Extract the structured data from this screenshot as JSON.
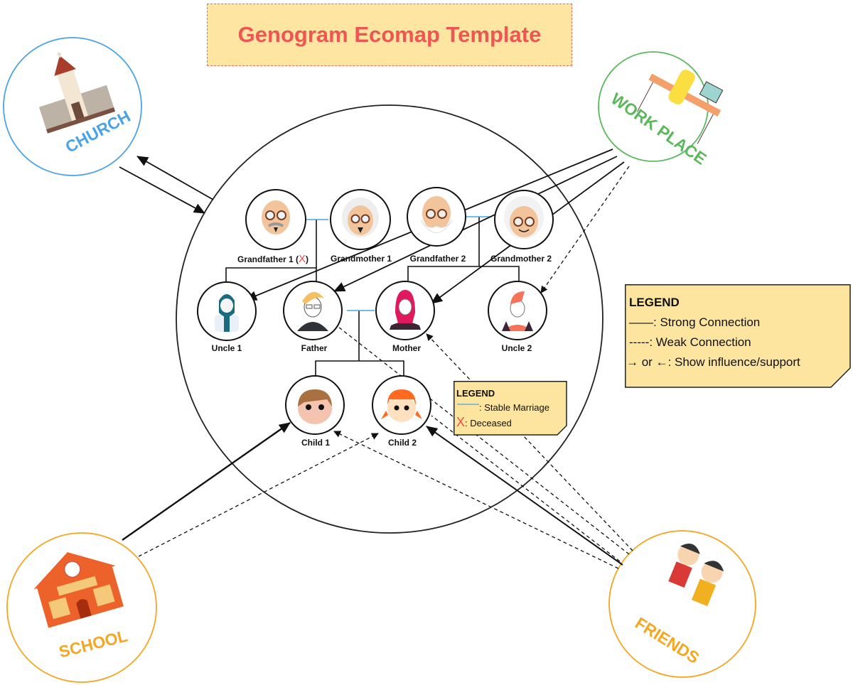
{
  "title": "Genogram Ecomap Template",
  "colors": {
    "title_text": "#ef5552",
    "title_bg": "#fee6a2",
    "legend_bg": "#fde49f",
    "marriage_line": "#4aa3e6",
    "deceased_x": "#ef4d4d",
    "church": "#4aa3e6",
    "workplace": "#5cb85c",
    "school": "#f5a623",
    "friends": "#f5a623"
  },
  "family": {
    "grandfather1": {
      "label": "Grandfather 1 (",
      "deceased_mark": "X",
      "label_end": ")"
    },
    "grandmother1": {
      "label": "Grandmother 1"
    },
    "grandfather2": {
      "label": "Grandfather 2"
    },
    "grandmother2": {
      "label": "Grandmother 2"
    },
    "uncle1": {
      "label": "Uncle 1"
    },
    "father": {
      "label": "Father"
    },
    "mother": {
      "label": "Mother"
    },
    "uncle2": {
      "label": "Uncle 2"
    },
    "child1": {
      "label": "Child 1"
    },
    "child2": {
      "label": "Child 2"
    }
  },
  "ecosystems": {
    "church": {
      "label": "CHURCH"
    },
    "workplace": {
      "label": "WORK PLACE"
    },
    "school": {
      "label": "SCHOOL",
      "sign": "SCHOOL"
    },
    "friends": {
      "label": "FRIENDS"
    }
  },
  "legend_main": {
    "title": "LEGEND",
    "items": [
      {
        "symbol": "——",
        "text": ": Strong Connection"
      },
      {
        "symbol": "-----",
        "text": ": Weak Connection"
      },
      {
        "symbol": "→ or ←",
        "text": ": Show influence/support"
      }
    ]
  },
  "legend_small": {
    "title": "LEGEND",
    "items": [
      {
        "symbol": "marriage-line",
        "text": ": Stable Marriage"
      },
      {
        "symbol": "X",
        "text": ": Deceased"
      }
    ]
  },
  "connections": [
    {
      "from": "church",
      "to": "family",
      "type": "strong",
      "direction": "to"
    },
    {
      "from": "family",
      "to": "church",
      "type": "strong",
      "direction": "to"
    },
    {
      "from": "workplace",
      "to": "uncle1",
      "type": "strong"
    },
    {
      "from": "workplace",
      "to": "father",
      "type": "strong"
    },
    {
      "from": "workplace",
      "to": "mother",
      "type": "strong"
    },
    {
      "from": "workplace",
      "to": "uncle2",
      "type": "weak"
    },
    {
      "from": "school",
      "to": "child1",
      "type": "strong"
    },
    {
      "from": "school",
      "to": "child2",
      "type": "weak"
    },
    {
      "from": "friends",
      "to": "child2",
      "type": "strong"
    },
    {
      "from": "friends",
      "to": "child1",
      "type": "weak"
    },
    {
      "from": "friends",
      "to": "father",
      "type": "weak"
    },
    {
      "from": "friends",
      "to": "mother",
      "type": "weak"
    }
  ]
}
